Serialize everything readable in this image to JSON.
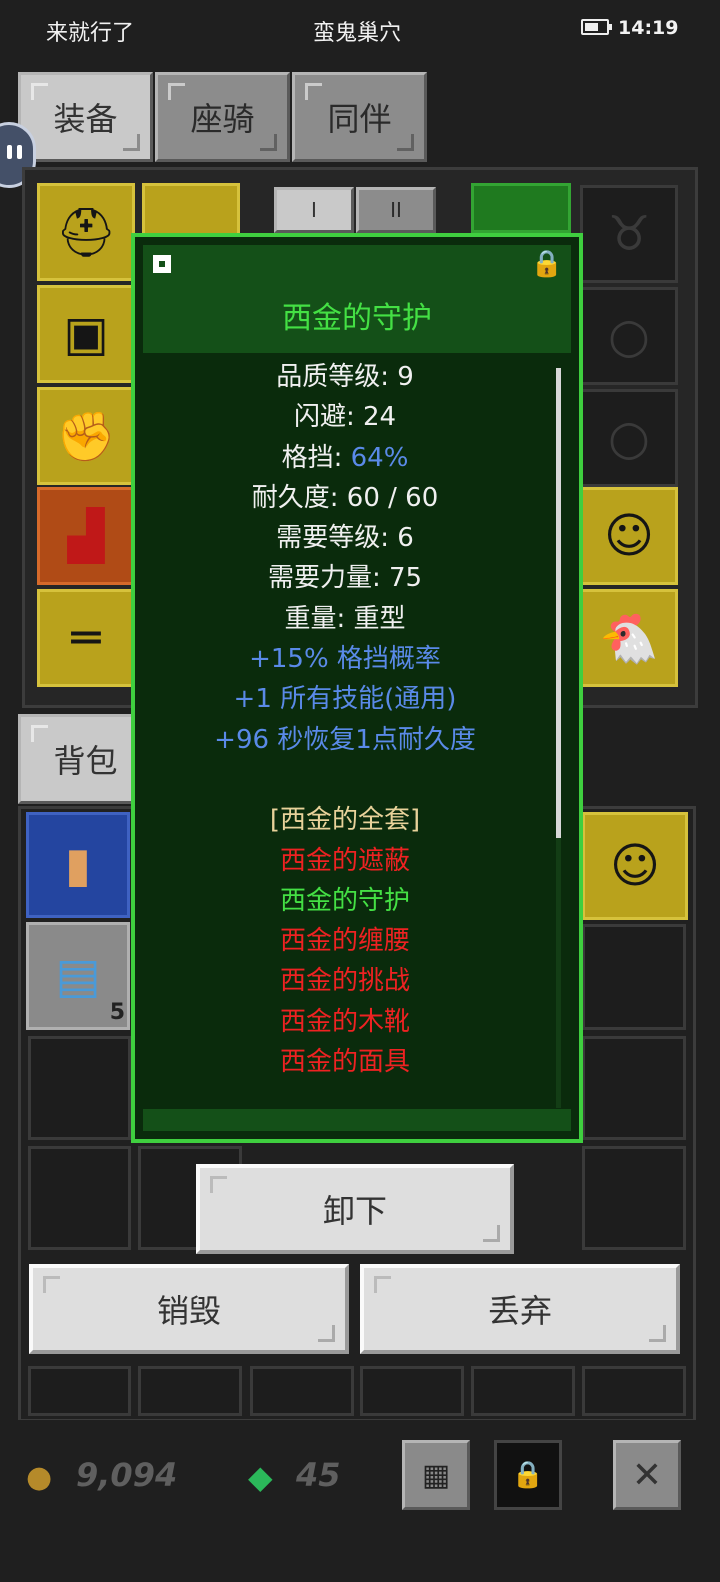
{
  "status_bar": {
    "left_text": "来就行了",
    "center_title": "蛮鬼巢穴",
    "time": "14:19"
  },
  "tabs": {
    "equipment": "装备",
    "mount": "座骑",
    "companion": "同伴",
    "backpack": "背包"
  },
  "subtabs": {
    "first": "I",
    "second": "II"
  },
  "tooltip": {
    "item_name": "西金的守护",
    "stats": [
      {
        "label": "品质等级: ",
        "value": "9"
      },
      {
        "label": "闪避: ",
        "value": "24"
      },
      {
        "label": "格挡: ",
        "value": "64%"
      },
      {
        "label": "耐久度: ",
        "value": "60 / 60"
      },
      {
        "label": "需要等级: ",
        "value": "6"
      },
      {
        "label": "需要力量: ",
        "value": "75"
      },
      {
        "label": "重量: ",
        "value": "重型"
      }
    ],
    "affixes": [
      "+15% 格挡概率",
      "+1 所有技能(通用)",
      "+96 秒恢复1点耐久度"
    ],
    "set_title": "[西金的全套]",
    "set_items": [
      {
        "name": "西金的遮蔽",
        "owned": false
      },
      {
        "name": "西金的守护",
        "owned": true
      },
      {
        "name": "西金的缠腰",
        "owned": false
      },
      {
        "name": "西金的挑战",
        "owned": false
      },
      {
        "name": "西金的木靴",
        "owned": false
      },
      {
        "name": "西金的面具",
        "owned": false
      }
    ]
  },
  "buttons": {
    "unequip": "卸下",
    "destroy": "销毁",
    "drop": "丢弃"
  },
  "inventory": {
    "scroll_count": "5"
  },
  "currency": {
    "gold": "9,094",
    "gems": "45"
  },
  "icons": {
    "gold": "gold-coins-icon",
    "gem": "green-gem-icon",
    "grid": "grid-icon",
    "lock": "lock-icon",
    "close": "close-icon"
  },
  "colors": {
    "tooltip_border": "#3fcf3f",
    "set_owned": "#44e044",
    "set_missing": "#ee2222",
    "affix": "#5a8ae8"
  }
}
